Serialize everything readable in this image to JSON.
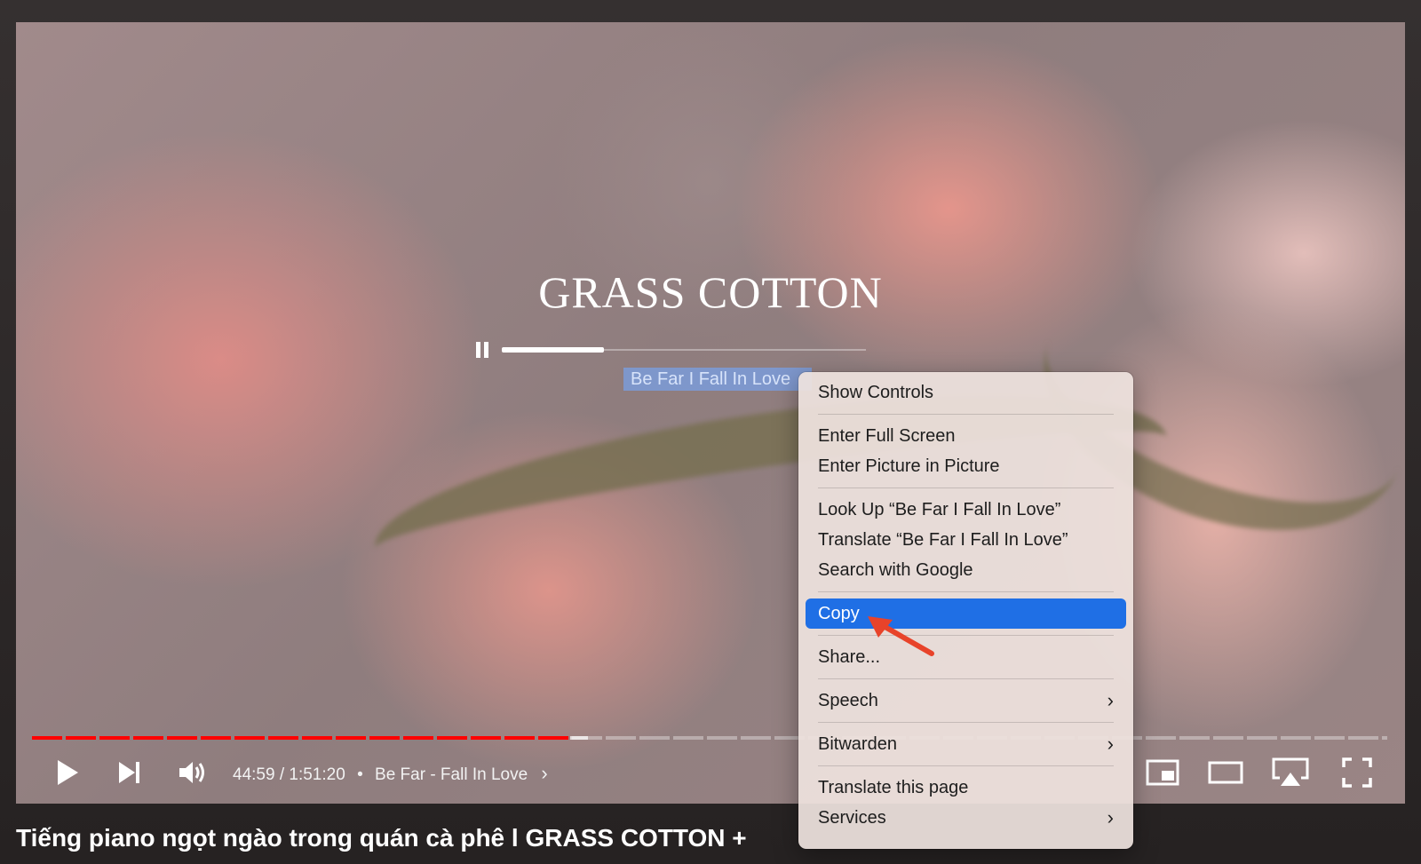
{
  "video": {
    "overlay_title": "GRASS COTTON",
    "overlay_song": "Be Far I Fall In Love",
    "overlay_progress": 0.28
  },
  "player": {
    "played_fraction": 0.397,
    "buffered_fraction": 0.41,
    "current_time": "44:59",
    "duration": "1:51:20",
    "separator": "•",
    "chapter": "Be Far - Fall In Love",
    "icons": [
      "play-icon",
      "next-icon",
      "volume-icon",
      "chapter-chevron-icon",
      "miniplayer-icon",
      "theater-mode-icon",
      "airplay-icon",
      "fullscreen-icon"
    ]
  },
  "page": {
    "title": "Tiếng piano ngọt ngào trong quán cà phê l GRASS COTTON +"
  },
  "context_menu": {
    "items": {
      "show_controls": "Show Controls",
      "enter_full_screen": "Enter Full Screen",
      "enter_pip": "Enter Picture in Picture",
      "look_up": "Look Up “Be Far I Fall In Love”",
      "translate": "Translate “Be Far I Fall In Love”",
      "search_google": "Search with Google",
      "copy": "Copy",
      "share": "Share...",
      "speech": "Speech",
      "bitwarden": "Bitwarden",
      "translate_page": "Translate this page",
      "services": "Services"
    },
    "submenu_arrow": "›",
    "highlighted": "Copy",
    "highlight_color": "#1f6fe5"
  },
  "annotation": {
    "arrow_color": "#e8432a"
  }
}
